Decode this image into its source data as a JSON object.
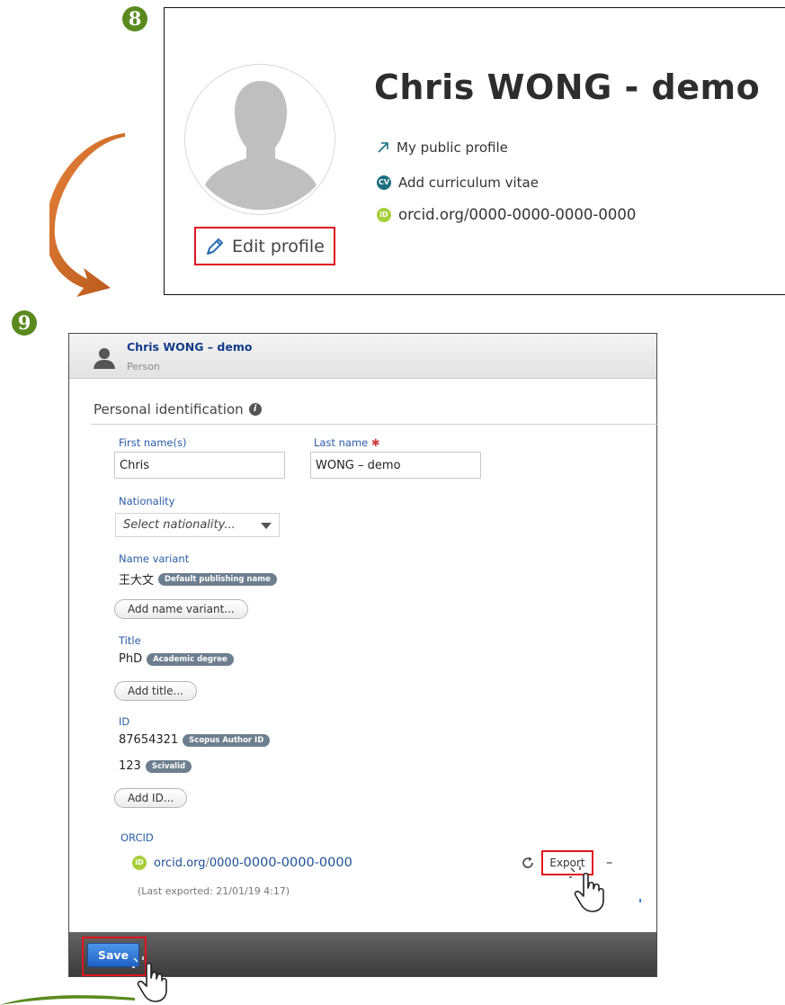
{
  "badges": {
    "step_top": "8",
    "step_bottom": "9"
  },
  "profile_card": {
    "name": "Chris WONG - demo",
    "links": {
      "public_profile": "My public profile",
      "add_cv": "Add curriculum vitae",
      "orcid": "orcid.org/0000-0000-0000-0000"
    },
    "cv_icon_text": "CV",
    "orcid_icon_text": "iD",
    "edit_profile_label": "Edit profile"
  },
  "editor": {
    "header": {
      "title": "Chris WONG – demo",
      "subtitle": "Person"
    },
    "section_title": "Personal identification",
    "info_icon_text": "i",
    "first_name": {
      "label": "First name(s)",
      "value": "Chris"
    },
    "last_name": {
      "label": "Last name",
      "required_mark": "✱",
      "value": "WONG – demo"
    },
    "nationality": {
      "label": "Nationality",
      "placeholder": "Select nationality..."
    },
    "name_variant": {
      "label": "Name variant",
      "value": "王大文",
      "badge": "Default publishing name",
      "add_button": "Add name variant..."
    },
    "title": {
      "label": "Title",
      "value": "PhD",
      "badge": "Academic degree",
      "add_button": "Add title..."
    },
    "id": {
      "label": "ID",
      "items": [
        {
          "value": "87654321",
          "badge": "Scopus Author ID"
        },
        {
          "value": "123",
          "badge": "Scivalid"
        }
      ],
      "add_button": "Add ID..."
    },
    "orcid": {
      "label": "ORCID",
      "prefix": "orcid.org",
      "separator": "/",
      "id_first": "0000-",
      "id_rest": "0000-0000-0000",
      "last_exported": "(Last exported: 21/01/19 4:17)",
      "export_button": "Export",
      "remove_label": "–"
    },
    "footer": {
      "save_button": "Save"
    }
  },
  "colors": {
    "badge_green": "#5a8a1e",
    "highlight_red": "#e0141e",
    "link_blue": "#1d4f99",
    "orcid_green": "#a6ce39",
    "save_blue": "#1f62c7",
    "arrow_orange": "#d2691e"
  }
}
